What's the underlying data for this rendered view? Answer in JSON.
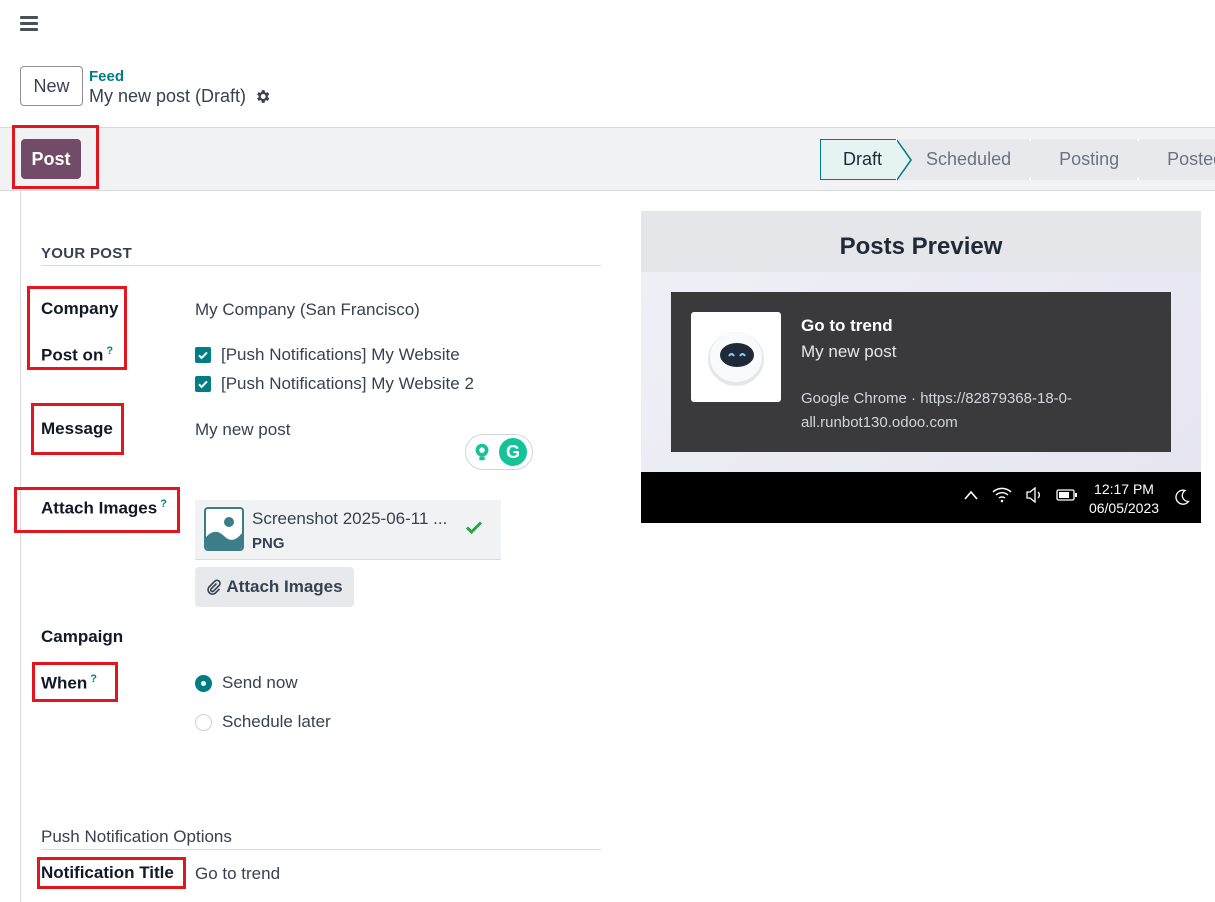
{
  "header": {
    "new_label": "New",
    "breadcrumb": "Feed",
    "record_title": "My new post (Draft)"
  },
  "toolbar": {
    "post_label": "Post"
  },
  "statusbar": {
    "stages": [
      "Draft",
      "Scheduled",
      "Posting",
      "Posted"
    ],
    "active": "Draft"
  },
  "form": {
    "section_title": "YOUR POST",
    "company_label": "Company",
    "company_value": "My Company (San Francisco)",
    "post_on_label": "Post on",
    "post_on_help": "?",
    "post_on_options": [
      "[Push Notifications] My Website",
      "[Push Notifications] My Website 2"
    ],
    "message_label": "Message",
    "message_value": "My new post",
    "attach_images_label": "Attach Images",
    "attach_images_help": "?",
    "attachment_name": "Screenshot 2025-06-11 ...",
    "attachment_type": "PNG",
    "attach_button_label": "Attach Images",
    "campaign_label": "Campaign",
    "when_label": "When",
    "when_help": "?",
    "when_options": [
      "Send now",
      "Schedule later"
    ],
    "when_selected": "Send now",
    "push_section": "Push Notification Options",
    "notification_title_label": "Notification Title",
    "notification_title_value": "Go to trend"
  },
  "preview": {
    "title": "Posts Preview",
    "notif_title": "Go to trend",
    "notif_body": "My new post",
    "notif_source": "Google Chrome · https://82879368-18-0-all.runbot130.odoo.com",
    "time": "12:17 PM",
    "date": "06/05/2023"
  },
  "colors": {
    "brand": "#714b67",
    "accent": "#017e84",
    "highlight": "#e3161f"
  }
}
